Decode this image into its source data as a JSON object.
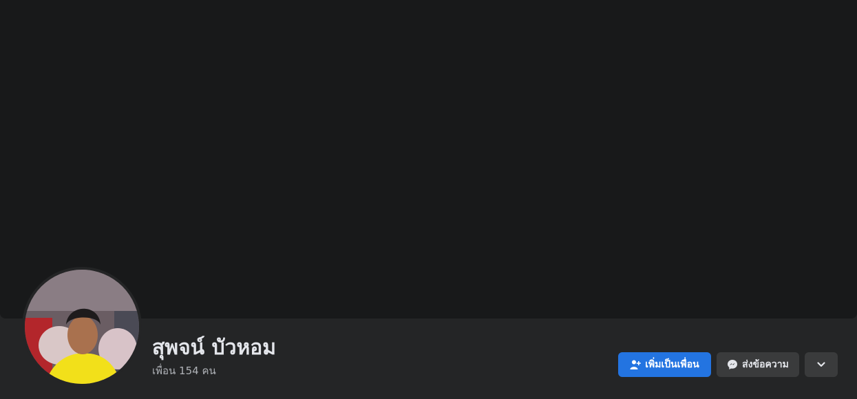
{
  "profile": {
    "name": "สุพจน์ บัวหอม",
    "friends_text": "เพื่อน 154 คน"
  },
  "actions": {
    "add_friend_label": "เพิ่มเป็นเพื่อน",
    "message_label": "ส่งข้อความ"
  },
  "icons": {
    "add_friend": "person-plus-icon",
    "message": "messenger-icon",
    "more": "chevron-down-icon"
  },
  "colors": {
    "primary": "#2374e1",
    "background": "#242526",
    "cover": "#18191a",
    "secondary_button": "#3a3b3c",
    "text": "#e4e6eb",
    "muted_text": "#b0b3b8"
  }
}
